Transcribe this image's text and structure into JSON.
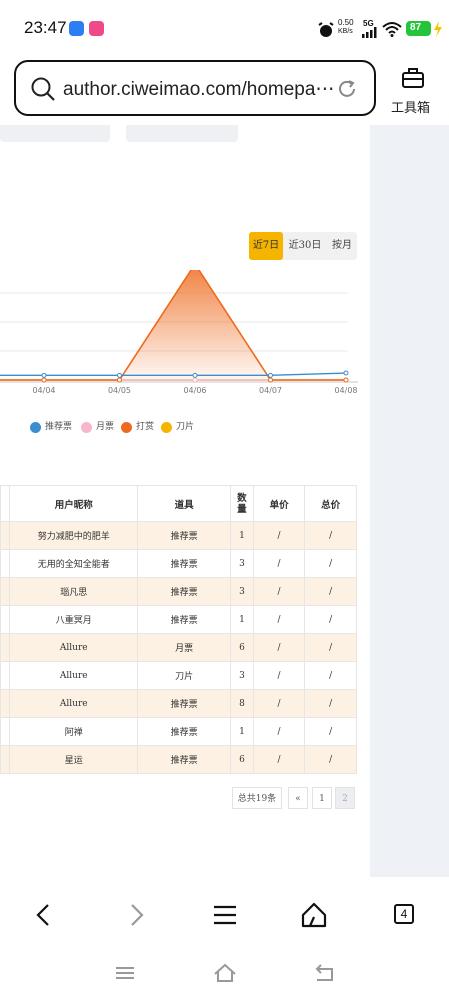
{
  "status_bar": {
    "time": "23:47",
    "net_speed_value": "0.50",
    "net_speed_unit": "KB/s",
    "signal": "5G",
    "battery": "87",
    "icons": [
      "alarm-icon",
      "signal-icon",
      "wifi-icon",
      "battery-icon",
      "charging-icon"
    ]
  },
  "browser": {
    "url": "author.ciweimao.com/homepa⋯",
    "toolbox_label": "工具箱"
  },
  "range_tabs": [
    {
      "label": "近7日",
      "active": true
    },
    {
      "label": "近30日",
      "active": false
    },
    {
      "label": "按月",
      "active": false
    }
  ],
  "chart_data": {
    "type": "line",
    "x": [
      "04/04",
      "04/05",
      "04/06",
      "04/07",
      "04/08"
    ],
    "series": [
      {
        "name": "推荐票",
        "color": "#3a8ed0",
        "values": [
          1,
          1,
          1,
          1,
          1.5
        ]
      },
      {
        "name": "月票",
        "color": "#f7b6cc",
        "values": [
          0,
          0,
          0,
          0,
          0
        ]
      },
      {
        "name": "打赏",
        "color": "#ee6a1f",
        "values": [
          0,
          0,
          25,
          0,
          0
        ]
      },
      {
        "name": "刀片",
        "color": "#f5b400",
        "values": [
          0,
          0,
          0,
          0,
          0
        ]
      }
    ],
    "ylim": [
      0,
      25
    ],
    "grid": true,
    "legend_position": "bottom"
  },
  "table": {
    "headers": [
      "用户昵称",
      "道具",
      "数量",
      "单价",
      "总价"
    ],
    "rows": [
      [
        "努力减肥中的肥羊",
        "推荐票",
        "1",
        "/",
        "/"
      ],
      [
        "无用的全知全能者",
        "推荐票",
        "3",
        "/",
        "/"
      ],
      [
        "瑙凡思",
        "推荐票",
        "3",
        "/",
        "/"
      ],
      [
        "八重冥月",
        "推荐票",
        "1",
        "/",
        "/"
      ],
      [
        "Allure",
        "月票",
        "6",
        "/",
        "/"
      ],
      [
        "Allure",
        "刀片",
        "3",
        "/",
        "/"
      ],
      [
        "Allure",
        "推荐票",
        "8",
        "/",
        "/"
      ],
      [
        "阿禅",
        "推荐票",
        "1",
        "/",
        "/"
      ],
      [
        "星运",
        "推荐票",
        "6",
        "/",
        "/"
      ]
    ]
  },
  "pager": {
    "total": "总共19条",
    "prev": "«",
    "pages": [
      "1",
      "2"
    ]
  },
  "nav_bar": {
    "tabs_count": "4"
  }
}
